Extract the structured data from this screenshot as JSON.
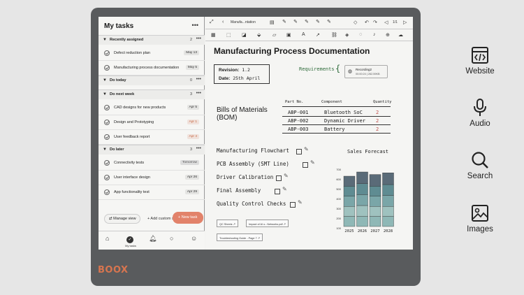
{
  "device": {
    "brand": "BOOX"
  },
  "tasks_panel": {
    "title": "My tasks",
    "sections": [
      {
        "label": "Recently assigned",
        "count": "2",
        "tasks": [
          {
            "title": "Defect reduction plan",
            "date": "May 13",
            "date_style": "normal"
          },
          {
            "title": "Manufacturing process documentation",
            "date": "May 5",
            "date_style": "normal"
          }
        ]
      },
      {
        "label": "Do today",
        "count": "0",
        "tasks": []
      },
      {
        "label": "Do next week",
        "count": "3",
        "tasks": [
          {
            "title": "CAD designs for new products",
            "date": "Apr 5",
            "date_style": "normal"
          },
          {
            "title": "Design and Prototyping",
            "date": "Apr 1",
            "date_style": "overdue"
          },
          {
            "title": "User feedback report",
            "date": "Apr 4",
            "date_style": "overdue"
          }
        ]
      },
      {
        "label": "Do later",
        "count": "3",
        "tasks": [
          {
            "title": "Connectivity tests",
            "date": "Tomorrow",
            "date_style": "soon"
          },
          {
            "title": "User interface design",
            "date": "Apr 26",
            "date_style": "normal"
          },
          {
            "title": "App functionality test",
            "date": "Apr 29",
            "date_style": "normal"
          }
        ]
      }
    ],
    "manage_view": "Manage view",
    "add_section": "+ Add custom section",
    "new_task": "+ New task",
    "nav": [
      {
        "icon": "home-icon",
        "label": ""
      },
      {
        "icon": "check-circle-icon",
        "label": "My tasks"
      },
      {
        "icon": "bell-icon",
        "label": ""
      },
      {
        "icon": "search-icon",
        "label": ""
      },
      {
        "icon": "person-icon",
        "label": ""
      }
    ]
  },
  "notebook": {
    "file_name": "Manufa...ntation",
    "page_indicator": "1/1",
    "title": "Manufacturing Process Documentation",
    "revision_label": "Revision:",
    "revision_value": "1.2",
    "date_label": "Date:",
    "date_value": "25th April",
    "requirements": "Requirements",
    "recording": {
      "name": "Recording2",
      "time": "00:00:24",
      "size": "262.59KB"
    },
    "bom_title_1": "Bills of Materials",
    "bom_title_2": "(BOM)",
    "bom_headers": [
      "Part No.",
      "Component",
      "Quantity"
    ],
    "bom_rows": [
      {
        "part": "ABP-001",
        "component": "Bluetooth SoC",
        "qty": "2"
      },
      {
        "part": "ABP-002",
        "component": "Dynamic Driver",
        "qty": "2"
      },
      {
        "part": "ABP-003",
        "component": "Battery",
        "qty": "2"
      }
    ],
    "checklist": [
      "Manufacturing Flowchart",
      "PCB Assembly (SMT Line)",
      "Driver Calibration",
      "Final Assembly",
      "Quality Control Checks"
    ],
    "sales_title": "Sales Forecast",
    "links": [
      "QC Sheets",
      "Impact of AI o...Networks.pdf",
      "Troubleshooting Guide - Page 7"
    ]
  },
  "chart_data": {
    "type": "bar",
    "title": "Sales Forecast",
    "categories": [
      "2025",
      "2026",
      "2027",
      "2028"
    ],
    "yticks": [
      "700",
      "600",
      "500",
      "400",
      "300",
      "200",
      "100"
    ],
    "ylim": [
      0,
      700
    ],
    "series": [
      {
        "values": [
          120,
          120,
          120,
          120
        ]
      },
      {
        "values": [
          120,
          130,
          120,
          120
        ]
      },
      {
        "values": [
          120,
          130,
          120,
          130
        ]
      },
      {
        "values": [
          120,
          130,
          120,
          130
        ]
      },
      {
        "values": [
          120,
          140,
          140,
          140
        ]
      }
    ],
    "colors": [
      "#8fb8b6",
      "#9fc2bf",
      "#7aa6a8",
      "#5f8c92",
      "#5a6b78"
    ]
  },
  "features": [
    {
      "icon": "code-window-icon",
      "label": "Website"
    },
    {
      "icon": "microphone-icon",
      "label": "Audio"
    },
    {
      "icon": "magnifier-icon",
      "label": "Search"
    },
    {
      "icon": "image-icon",
      "label": "Images"
    }
  ]
}
